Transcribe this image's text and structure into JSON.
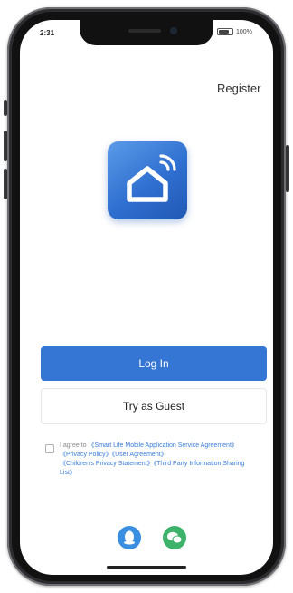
{
  "status_bar": {
    "time": "2:31",
    "battery_text": "100%",
    "icons": [
      "battery-icon"
    ]
  },
  "header": {
    "register_label": "Register"
  },
  "app_icon": {
    "name": "smart-home-app-icon",
    "icon": "house-with-signal-icon",
    "colors": {
      "top": "#5b9be8",
      "bottom": "#2258b4"
    }
  },
  "actions": {
    "login_label": "Log In",
    "guest_label": "Try as Guest"
  },
  "agreement": {
    "prefix": "I agree to ",
    "links": [
      "《Smart Life Mobile Application Service Agreement》",
      "《Privacy Policy》",
      "《User Agreement》",
      "《Children's Privacy Statement》",
      "《Third Party Information Sharing List》"
    ],
    "checked": false
  },
  "social_login": [
    {
      "name": "qq",
      "icon": "qq-icon",
      "color": "#3a8fe0"
    },
    {
      "name": "wechat",
      "icon": "wechat-icon",
      "color": "#3cb26a"
    }
  ],
  "colors": {
    "primary": "#3576d4",
    "link": "#3a7bd5"
  }
}
